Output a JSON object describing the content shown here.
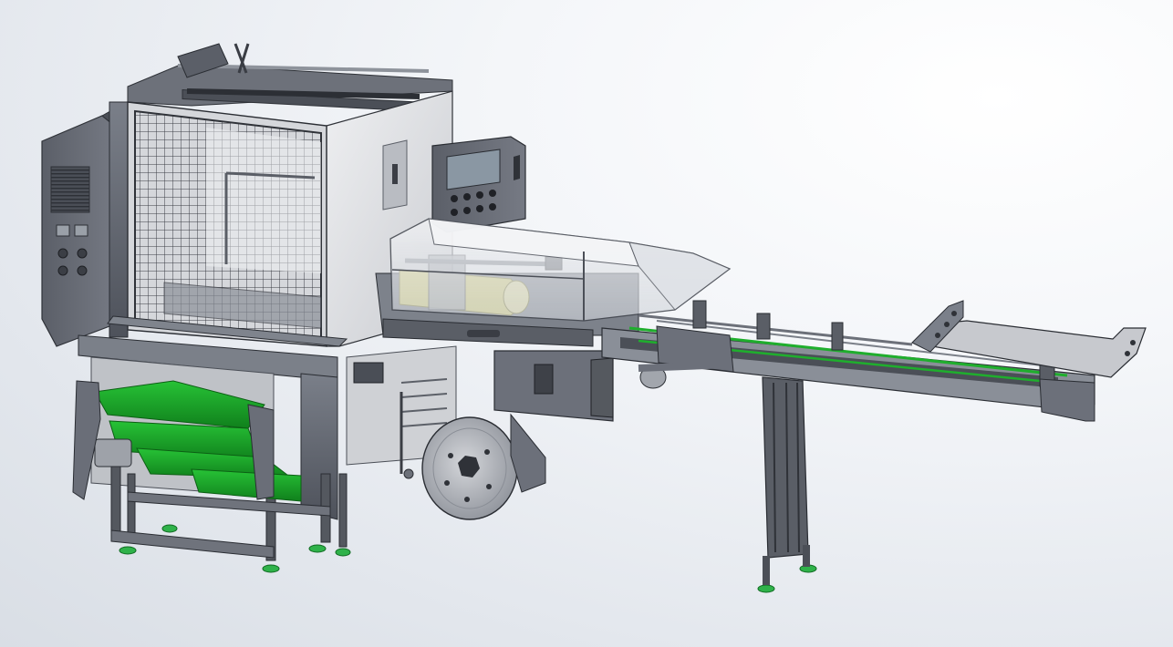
{
  "scene": {
    "name": "cad-render-packaging-machine",
    "palette": {
      "frame": "#5e626c",
      "frame_dark": "#3f434b",
      "frame_light": "#8b909a",
      "panel": "#6a6e78",
      "panel_light": "#d8d9dc",
      "guard_glass": "#e6e8ec",
      "accent_green": "#1fae2d",
      "accent_green_dark": "#0f7d1b",
      "product_yellow": "#d9d27a",
      "screen": "#7e8a96",
      "foot": "#2fb24a"
    }
  }
}
